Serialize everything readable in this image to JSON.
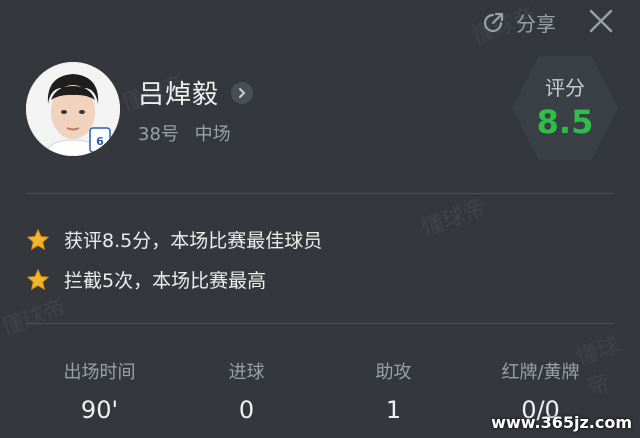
{
  "topbar": {
    "share_label": "分享"
  },
  "player": {
    "name": "吕焯毅",
    "number": "38号",
    "position": "中场"
  },
  "rating": {
    "label": "评分",
    "value": "8.5",
    "color": "#2fbf47"
  },
  "highlights": [
    {
      "icon": "star-icon",
      "text": "获评8.5分，本场比赛最佳球员"
    },
    {
      "icon": "star-icon",
      "text": "拦截5次，本场比赛最高"
    }
  ],
  "stats": [
    {
      "label": "出场时间",
      "value": "90'"
    },
    {
      "label": "进球",
      "value": "0"
    },
    {
      "label": "助攻",
      "value": "1"
    },
    {
      "label": "红牌/黄牌",
      "value": "0/0"
    }
  ],
  "watermark": "懂球帝",
  "site": "www.365jz.com"
}
